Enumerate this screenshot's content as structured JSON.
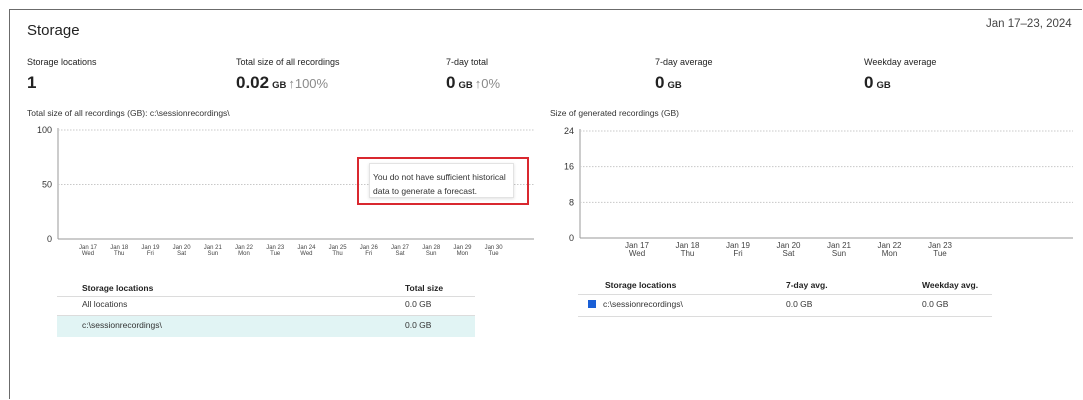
{
  "header": {
    "title": "Storage",
    "date_range": "Jan 17–23, 2024"
  },
  "stats": [
    {
      "label": "Storage locations",
      "value": "1",
      "unit": "",
      "change": ""
    },
    {
      "label": "Total size of all recordings",
      "value": "0.02",
      "unit": "GB",
      "change": "↑100%"
    },
    {
      "label": "7-day total",
      "value": "0",
      "unit": "GB",
      "change": "↑0%"
    },
    {
      "label": "7-day average",
      "value": "0",
      "unit": "GB",
      "change": ""
    },
    {
      "label": "Weekday average",
      "value": "0",
      "unit": "GB",
      "change": ""
    }
  ],
  "left_panel": {
    "chart_title": "Total size of all recordings (GB): c:\\sessionrecordings\\",
    "tooltip": "You do not have sufficient historical data to generate a forecast.",
    "table": {
      "headers": [
        "Storage locations",
        "Total size"
      ],
      "rows": [
        [
          "All locations",
          "0.0 GB"
        ],
        [
          "c:\\sessionrecordings\\",
          "0.0 GB"
        ]
      ]
    }
  },
  "right_panel": {
    "chart_title": "Size of generated recordings (GB)",
    "table": {
      "headers": [
        "Storage locations",
        "7-day avg.",
        "Weekday avg."
      ],
      "rows": [
        [
          "c:\\sessionrecordings\\",
          "0.0 GB",
          "0.0 GB"
        ]
      ]
    },
    "legend_color": "#1a5fd6"
  },
  "chart_data": [
    {
      "type": "line",
      "title": "Total size of all recordings (GB): c:\\sessionrecordings\\",
      "categories": [
        [
          "Jan 17",
          "Wed"
        ],
        [
          "Jan 18",
          "Thu"
        ],
        [
          "Jan 19",
          "Fri"
        ],
        [
          "Jan 20",
          "Sat"
        ],
        [
          "Jan 21",
          "Sun"
        ],
        [
          "Jan 22",
          "Mon"
        ],
        [
          "Jan 23",
          "Tue"
        ],
        [
          "Jan 24",
          "Wed"
        ],
        [
          "Jan 25",
          "Thu"
        ],
        [
          "Jan 26",
          "Fri"
        ],
        [
          "Jan 27",
          "Sat"
        ],
        [
          "Jan 28",
          "Sun"
        ],
        [
          "Jan 29",
          "Mon"
        ],
        [
          "Jan 30",
          "Tue"
        ]
      ],
      "y_ticks": [
        0,
        50,
        100
      ],
      "ylim": [
        0,
        100
      ],
      "series": [],
      "grid": true
    },
    {
      "type": "bar",
      "title": "Size of generated recordings (GB)",
      "categories": [
        [
          "Jan 17",
          "Wed"
        ],
        [
          "Jan 18",
          "Thu"
        ],
        [
          "Jan 19",
          "Fri"
        ],
        [
          "Jan 20",
          "Sat"
        ],
        [
          "Jan 21",
          "Sun"
        ],
        [
          "Jan 22",
          "Mon"
        ],
        [
          "Jan 23",
          "Tue"
        ]
      ],
      "y_ticks": [
        0,
        8,
        16,
        24
      ],
      "ylim": [
        0,
        24
      ],
      "series": [
        {
          "values": [
            0,
            0,
            0,
            0,
            0,
            0,
            0
          ]
        }
      ],
      "grid": true
    }
  ]
}
